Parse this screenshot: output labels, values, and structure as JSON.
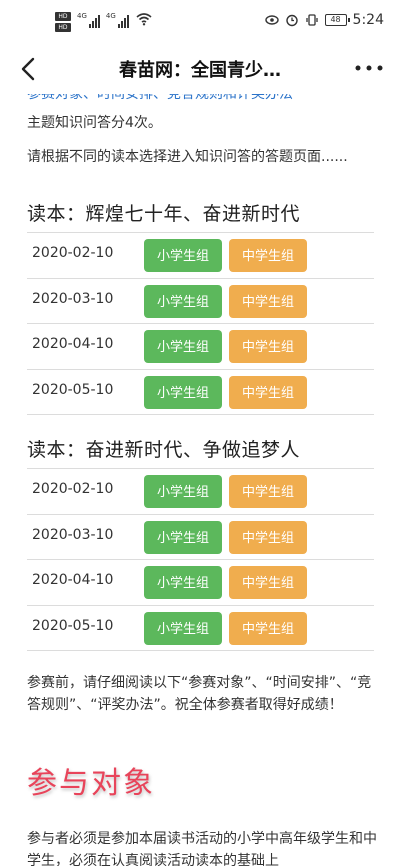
{
  "status_bar": {
    "hd1": "HD",
    "hd2": "HD",
    "net1": "4G",
    "net2": "4G",
    "battery": "48",
    "time": "5:24"
  },
  "nav": {
    "title": "春苗网：全国青少…"
  },
  "content": {
    "cutoff_text": "参赛对象、时间安排、竞答规则和评奖办法",
    "intro_line1": "主题知识问答分4次。",
    "intro_line2": "请根据不同的读本选择进入知识问答的答题页面......",
    "books": [
      {
        "title": "读本：辉煌七十年、奋进新时代",
        "rows": [
          {
            "date": "2020-02-10",
            "primary": "小学生组",
            "middle": "中学生组"
          },
          {
            "date": "2020-03-10",
            "primary": "小学生组",
            "middle": "中学生组"
          },
          {
            "date": "2020-04-10",
            "primary": "小学生组",
            "middle": "中学生组"
          },
          {
            "date": "2020-05-10",
            "primary": "小学生组",
            "middle": "中学生组"
          }
        ]
      },
      {
        "title": "读本：奋进新时代、争做追梦人",
        "rows": [
          {
            "date": "2020-02-10",
            "primary": "小学生组",
            "middle": "中学生组"
          },
          {
            "date": "2020-03-10",
            "primary": "小学生组",
            "middle": "中学生组"
          },
          {
            "date": "2020-04-10",
            "primary": "小学生组",
            "middle": "中学生组"
          },
          {
            "date": "2020-05-10",
            "primary": "小学生组",
            "middle": "中学生组"
          }
        ]
      }
    ],
    "notice": "参赛前，请仔细阅读以下“参赛对象”、“时间安排”、“竞答规则”、“评奖办法”。祝全体参赛者取得好成绩！",
    "participants_heading": "参与对象",
    "participants_text": "参与者必须是参加本届读书活动的小学中高年级学生和中学生，必须在认真阅读活动读本的基础上"
  },
  "colors": {
    "primary_button": "#5cb85c",
    "middle_button": "#f0ad4e",
    "heading_red": "#e8445a",
    "link_blue": "#2b73c9"
  },
  "icons": {
    "back": "chevron-left-icon",
    "more": "more-dots-icon"
  }
}
